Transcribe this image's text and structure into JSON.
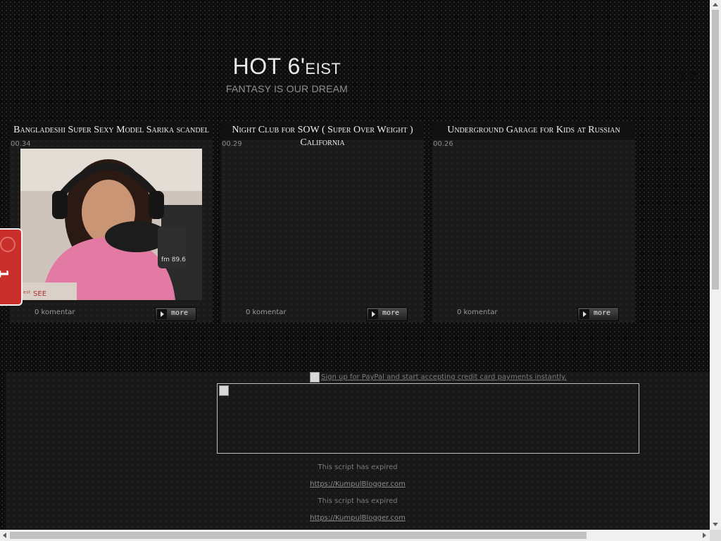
{
  "header": {
    "title_main": "HOT 6'",
    "title_small": "eist",
    "tagline": "FANTASY IS OUR DREAM",
    "side_counter": "1 2"
  },
  "posts": [
    {
      "title": "Bangladeshi Super Sexy Model Sarika scandel",
      "date": "00.34",
      "comments": "0 komentar",
      "more_label": "more",
      "has_image": true
    },
    {
      "title": "Night Club for SOW ( Super Over Weight ) California",
      "date": "00.29",
      "comments": "0 komentar",
      "more_label": "more",
      "has_image": false
    },
    {
      "title": "Underground Garage for Kids at Russian",
      "date": "00.26",
      "comments": "0 komentar",
      "more_label": "more",
      "has_image": false
    }
  ],
  "side_tab": {
    "label": "1"
  },
  "footer": {
    "paypal_alt": "Sign up for PayPal and start accepting credit card payments instantly.",
    "lines": [
      {
        "text": "This script has expired",
        "link": false
      },
      {
        "text": "https://KumpulBlogger.com",
        "link": true
      },
      {
        "text": "This script has expired",
        "link": false
      },
      {
        "text": "https://KumpulBlogger.com",
        "link": true
      }
    ]
  },
  "colors": {
    "background": "#0b0b0b",
    "panel": "#1a1a1a",
    "title_text": "#efefef",
    "accent_tab": "#c9302c"
  }
}
